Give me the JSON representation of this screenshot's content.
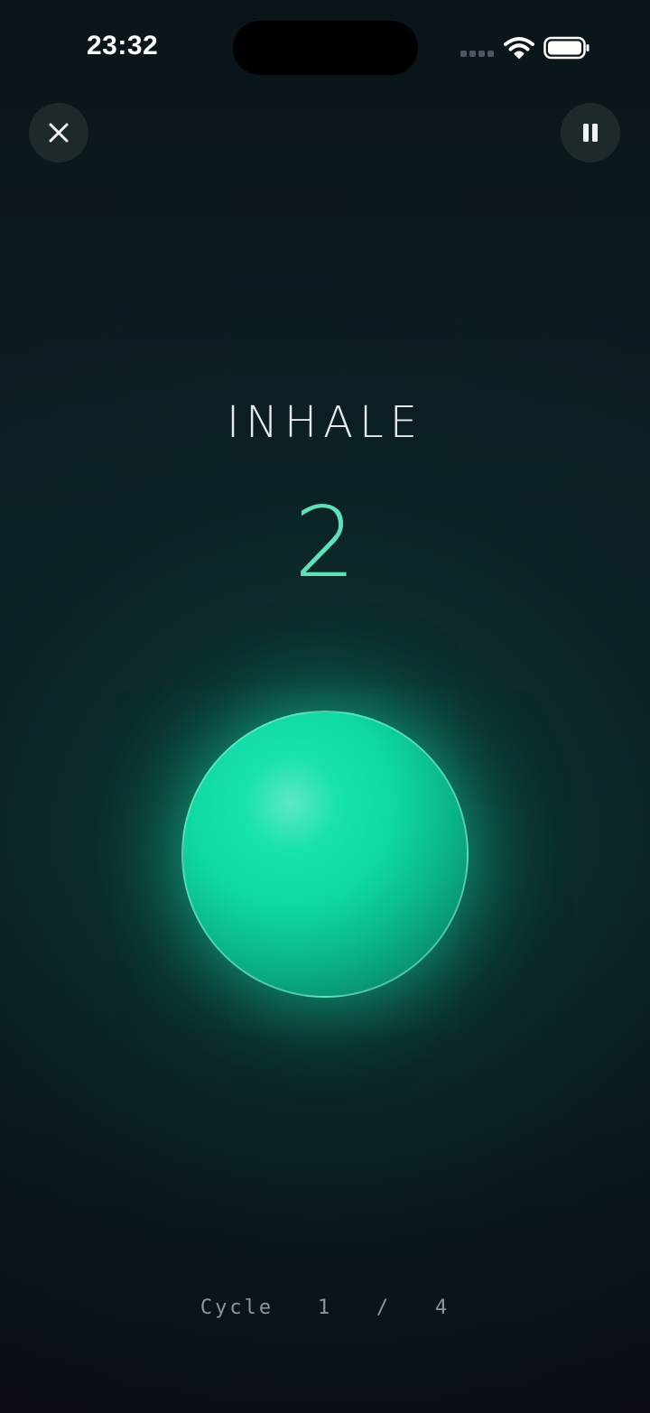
{
  "status_bar": {
    "time": "23:32",
    "icons": [
      "cellular-signal-icon",
      "wifi-icon",
      "battery-icon"
    ]
  },
  "controls": {
    "close_icon": "close-icon",
    "pause_icon": "pause-icon"
  },
  "breathing": {
    "phase": "INHALE",
    "count": "2"
  },
  "footer": {
    "cycle_word": "Cycle",
    "cycle_current": "1",
    "cycle_separator": "/",
    "cycle_total": "4"
  },
  "colors": {
    "background": "#0a0f16",
    "accent": "#5fe0b8",
    "orb": "#18e2ae"
  }
}
